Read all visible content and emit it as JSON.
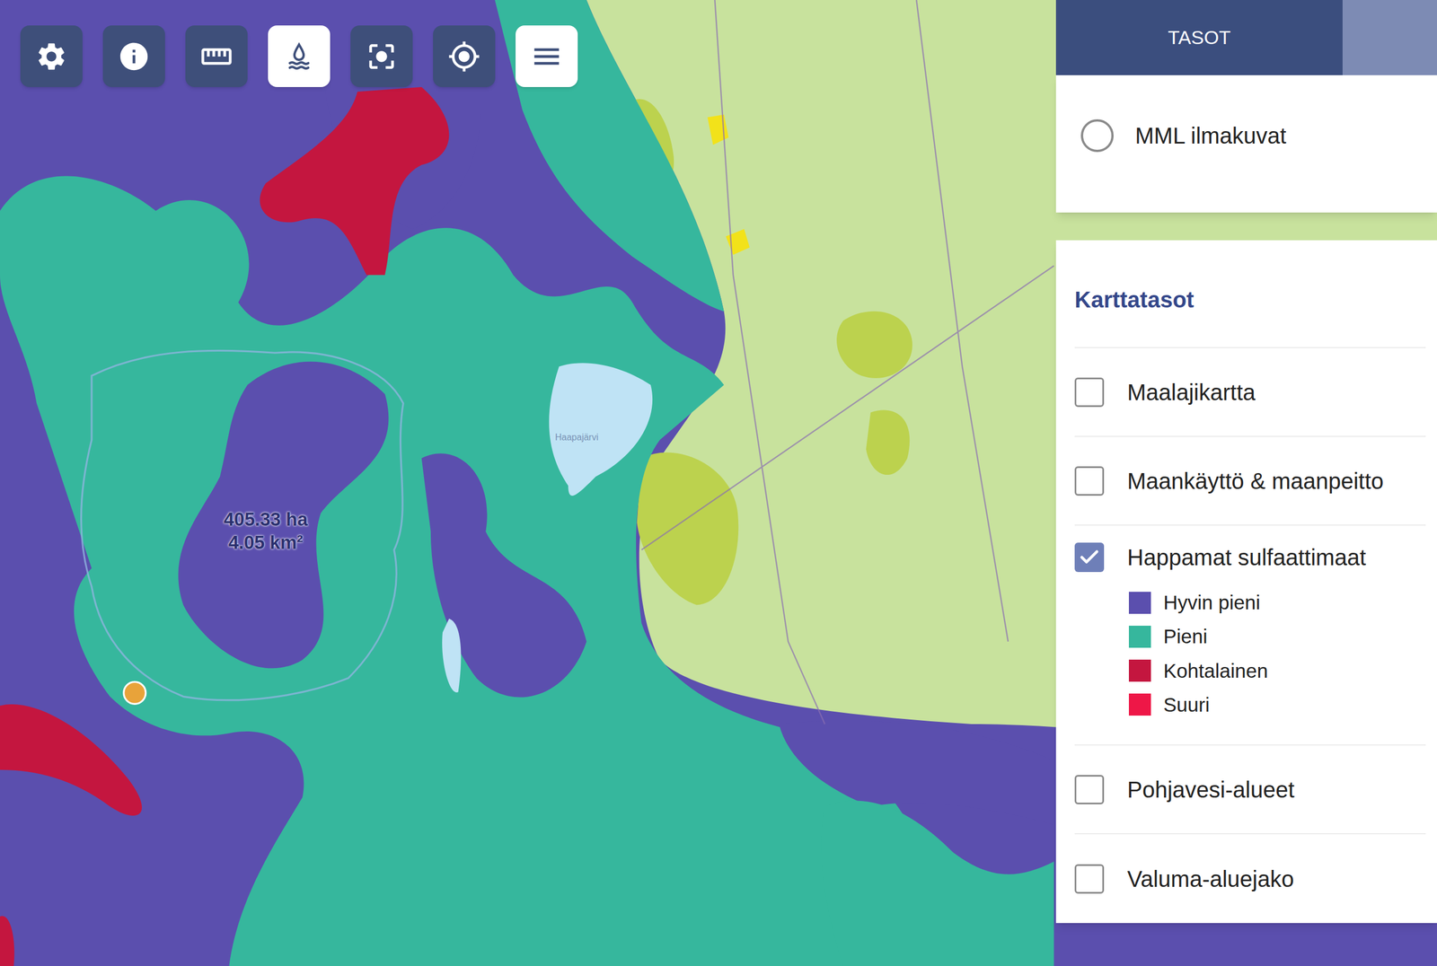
{
  "toolbar": [
    {
      "selected": false
    },
    {
      "selected": false
    },
    {
      "selected": false
    },
    {
      "selected": true
    },
    {
      "selected": false
    },
    {
      "selected": false
    },
    {
      "selected": true
    }
  ],
  "panel": {
    "tabs": [
      {
        "label": "TASOT",
        "selected": true
      },
      {
        "label": "",
        "selected": false
      }
    ],
    "basemaps": [
      {
        "label": "MML ilmakuvat",
        "selected": false
      }
    ],
    "layers_title": "Karttatasot",
    "layers": [
      {
        "label": "Maalajikartta",
        "checked": false
      },
      {
        "label": "Maankäyttö & maanpeitto",
        "checked": false
      },
      {
        "label": "Happamat sulfaattimaat",
        "checked": true,
        "legend": [
          {
            "label": "Hyvin pieni",
            "color": "#5b4fae"
          },
          {
            "label": "Pieni",
            "color": "#36b79d"
          },
          {
            "label": "Kohtalainen",
            "color": "#c4163f"
          },
          {
            "label": "Suuri",
            "color": "#ee1747"
          }
        ]
      },
      {
        "label": "Pohjavesi-alueet",
        "checked": false
      },
      {
        "label": "Valuma-aluejako",
        "checked": false
      }
    ]
  },
  "map": {
    "area_label": [
      "405.33 ha",
      "4.05 km²"
    ],
    "lake_label": "Haapajärvi",
    "pins": [
      {
        "color": "#e8a33a"
      }
    ]
  }
}
